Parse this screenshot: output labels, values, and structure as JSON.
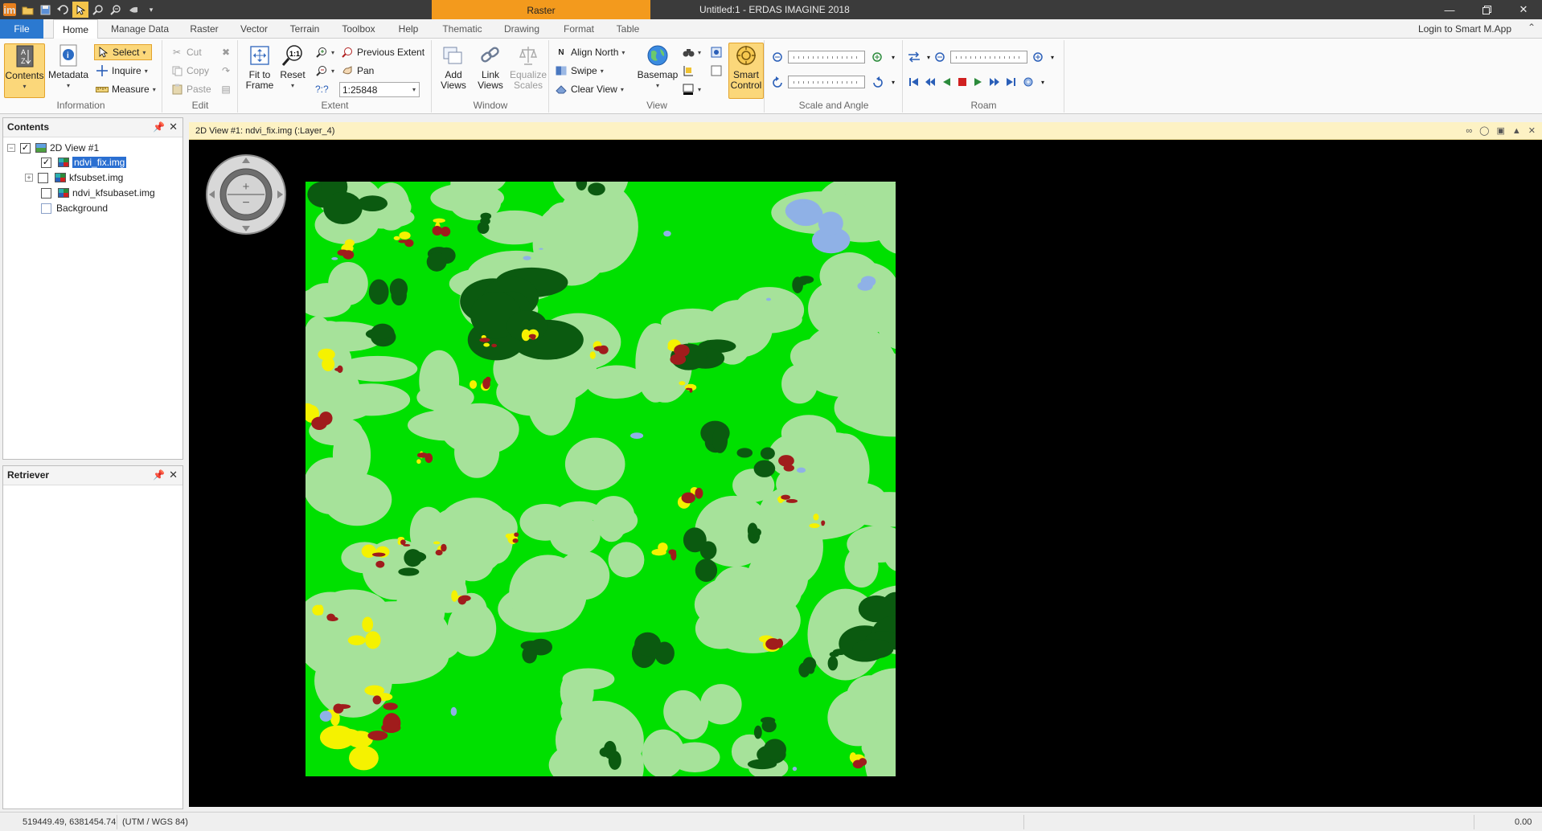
{
  "window": {
    "title": "Untitled:1 - ERDAS IMAGINE 2018",
    "raster_context_tab": "Raster",
    "minimize_icon": "minimize-icon",
    "maximize_icon": "maximize-icon",
    "close_icon": "close-icon"
  },
  "quick_access": {
    "logo": "im",
    "icons": [
      "open-folder-icon",
      "save-icon",
      "undo-icon",
      "select-arrow-icon",
      "zoom-in-icon",
      "zoom-out-icon",
      "pan-hand-icon",
      "customize-icon"
    ]
  },
  "tabs": {
    "file": "File",
    "items": [
      "Home",
      "Manage Data",
      "Raster",
      "Vector",
      "Terrain",
      "Toolbox",
      "Help",
      "Thematic",
      "Drawing",
      "Format",
      "Table"
    ],
    "active": "Home",
    "login": "Login to Smart M.App"
  },
  "ribbon": {
    "information": {
      "label": "Information",
      "contents": "Contents",
      "metadata": "Metadata",
      "select": "Select",
      "inquire": "Inquire",
      "measure": "Measure"
    },
    "edit": {
      "label": "Edit",
      "cut": "Cut",
      "copy": "Copy",
      "paste": "Paste"
    },
    "extent": {
      "label": "Extent",
      "fit_to_frame_1": "Fit to",
      "fit_to_frame_2": "Frame",
      "reset": "Reset",
      "previous_extent": "Previous Extent",
      "pan": "Pan",
      "scale_value": "1:25848",
      "unknown_scale": "?:?"
    },
    "window": {
      "label": "Window",
      "add_views_1": "Add",
      "add_views_2": "Views",
      "link_views_1": "Link",
      "link_views_2": "Views",
      "equalize_scales_1": "Equalize",
      "equalize_scales_2": "Scales"
    },
    "view": {
      "label": "View",
      "align_north": "Align North",
      "swipe": "Swipe",
      "clear_view": "Clear View",
      "basemap": "Basemap",
      "smart_control_1": "Smart",
      "smart_control_2": "Control"
    },
    "scale_angle": {
      "label": "Scale and Angle"
    },
    "roam": {
      "label": "Roam"
    }
  },
  "contents_panel": {
    "title": "Contents",
    "tree": {
      "root": "2D View #1",
      "layers": [
        "ndvi_fix.img",
        "kfsubset.img",
        "ndvi_kfsubaset.img",
        "Background"
      ],
      "checked": [
        true,
        false,
        false,
        false
      ]
    }
  },
  "retriever_panel": {
    "title": "Retriever"
  },
  "view": {
    "header": "2D View #1: ndvi_fix.img (:Layer_4)"
  },
  "statusbar": {
    "coordinates": "519449.49, 6381454.74",
    "projection": "(UTM / WGS 84)",
    "value": "0.00"
  },
  "colors": {
    "accent_orange": "#f39a1d",
    "file_tab_blue": "#2b79d0",
    "view_header_yellow": "#fdf2c4",
    "class_bright_green": "#00e000",
    "class_light_green": "#a6e29a",
    "class_dark_green": "#0b5a10",
    "class_yellow": "#f5f200",
    "class_red": "#a01c1c",
    "class_blue": "#8fb1e6"
  }
}
